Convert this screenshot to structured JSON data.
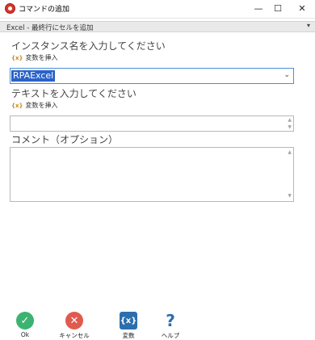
{
  "window": {
    "title": "コマンドの追加",
    "minimize": "—",
    "maximize": "☐",
    "close": "✕"
  },
  "command_select": {
    "value": "Excel - 最終行にセルを追加",
    "arrow": "▾"
  },
  "fields": {
    "instance_label": "インスタンス名を入力してください",
    "instance_var_insert": "変数を挿入",
    "instance_value": "RPAExcel",
    "text_label": "テキストを入力してください",
    "text_var_insert": "変数を挿入",
    "text_value": "",
    "comment_label": "コメント（オプション）",
    "comment_value": ""
  },
  "icons": {
    "var_icon": "{x}",
    "combo_chevron": "⌄",
    "scroll_up": "▲",
    "scroll_down": "▼"
  },
  "toolbar": {
    "ok_label": "Ok",
    "ok_glyph": "✓",
    "cancel_label": "キャンセル",
    "cancel_glyph": "✕",
    "variables_label": "変数",
    "variables_glyph": "{x}",
    "help_label": "ヘルプ",
    "help_glyph": "?"
  },
  "colors": {
    "ok": "#3cb371",
    "cancel": "#e05a4e",
    "variables": "#2c6fad",
    "help": "#2c6fad",
    "selection": "#2a62c8"
  }
}
